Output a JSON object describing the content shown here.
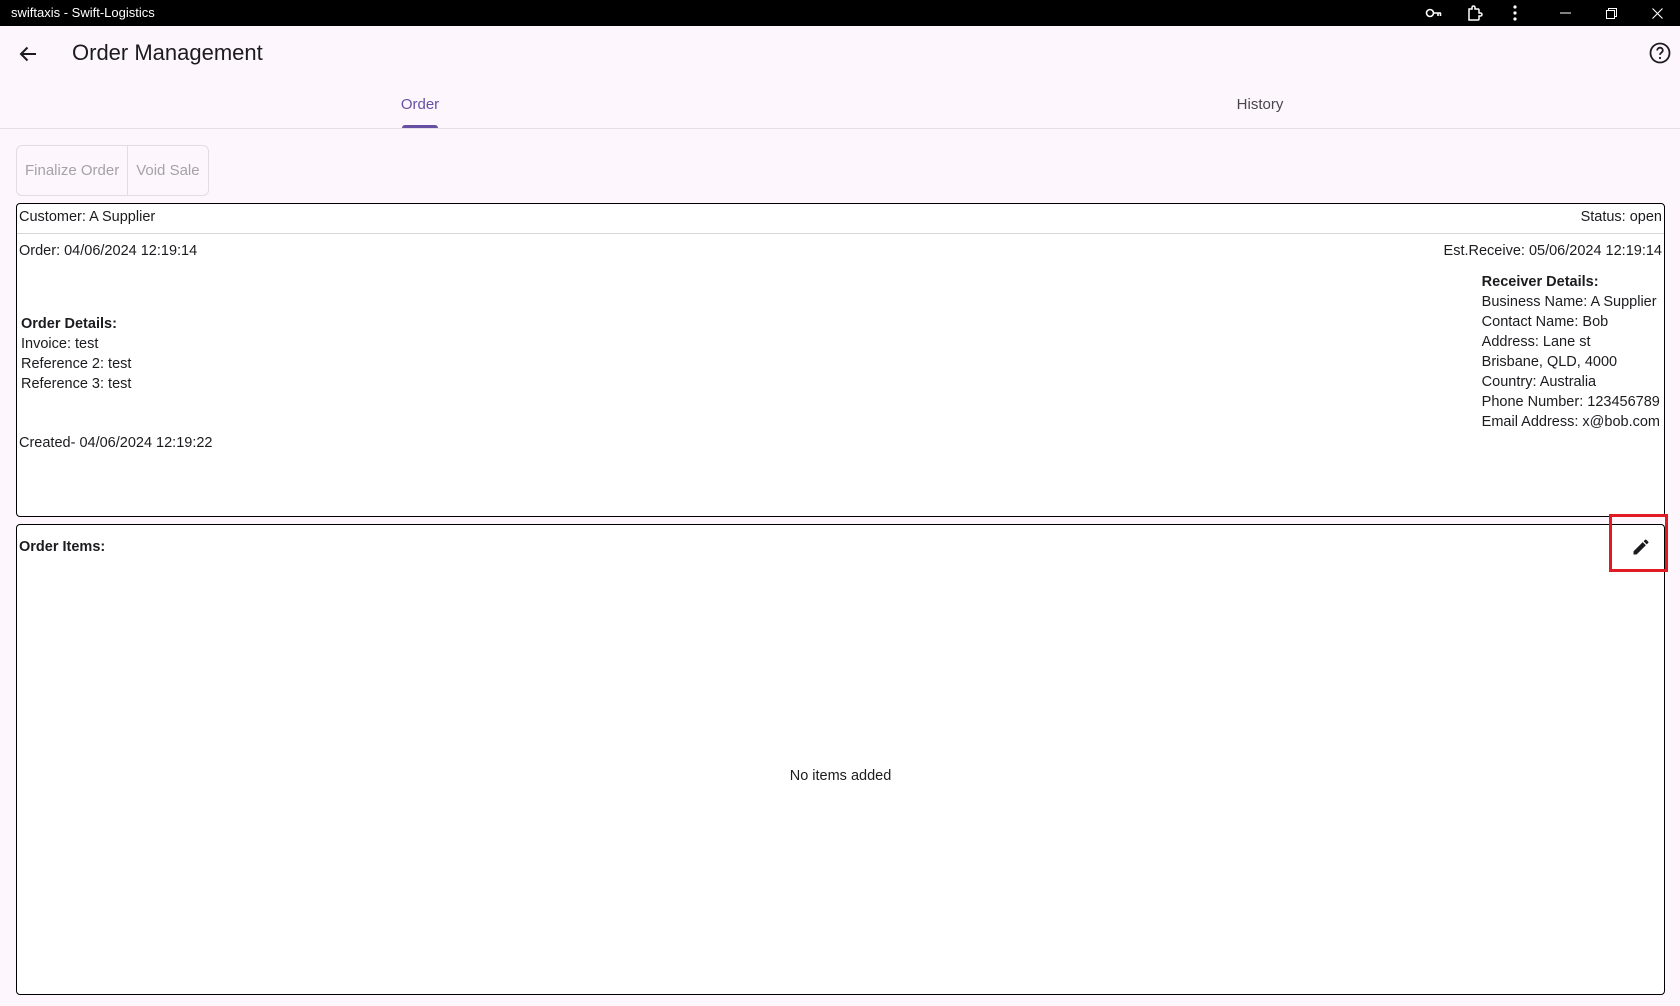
{
  "window": {
    "title": "swiftaxis - Swift-Logistics"
  },
  "appbar": {
    "title": "Order Management"
  },
  "tabs": [
    {
      "label": "Order",
      "active": true
    },
    {
      "label": "History",
      "active": false
    }
  ],
  "actions": {
    "finalize_label": "Finalize Order",
    "void_label": "Void Sale"
  },
  "order": {
    "customer": "Customer: A Supplier",
    "status": "Status: open",
    "order_date": "Order: 04/06/2024 12:19:14",
    "est_receive": "Est.Receive: 05/06/2024 12:19:14",
    "created": "Created- 04/06/2024 12:19:22",
    "details": {
      "heading": "Order Details:",
      "invoice": "Invoice: test",
      "reference2": "Reference 2: test",
      "reference3": "Reference 3: test"
    },
    "receiver": {
      "heading": "Receiver Details:",
      "business": "Business Name: A Supplier",
      "contact": "Contact Name: Bob",
      "address": "Address: Lane st",
      "city": "Brisbane, QLD,  4000",
      "country": "Country: Australia",
      "phone": "Phone Number: 123456789",
      "email": "Email Address: x@bob.com"
    }
  },
  "items": {
    "heading": "Order Items:",
    "empty_text": "No items added"
  },
  "colors": {
    "accent": "#6750a4",
    "highlight": "#e01b24",
    "background": "#fdf7fd"
  }
}
